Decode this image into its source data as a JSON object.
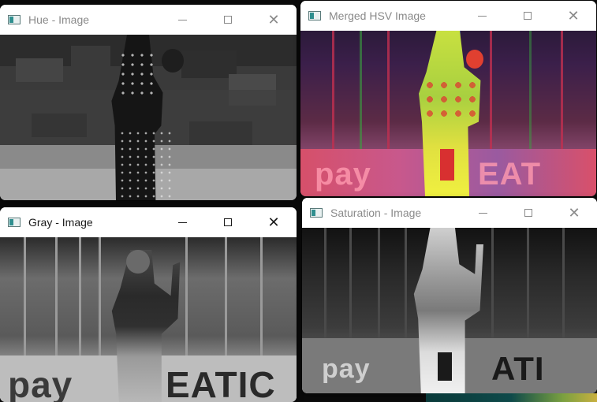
{
  "windows": {
    "hue": {
      "title": "Hue - Image",
      "active": false
    },
    "merged": {
      "title": "Merged HSV Image",
      "active": false
    },
    "gray": {
      "title": "Gray - Image",
      "active": true
    },
    "saturation": {
      "title": "Saturation - Image",
      "active": false
    }
  },
  "image_text": {
    "banner_left": "pay",
    "banner_right": "EAT",
    "banner_right_gray": "EATIC",
    "banner_right_sat": "ATI"
  },
  "icons": {
    "app": "opencv-window-icon",
    "minimize": "minimize-icon",
    "maximize": "maximize-icon",
    "close": "close-icon"
  },
  "colors": {
    "titlebar": "#ffffff",
    "title_active": "#1b1b1b",
    "title_inactive": "#8a8a8a",
    "desktop": "#0b0b0b"
  }
}
